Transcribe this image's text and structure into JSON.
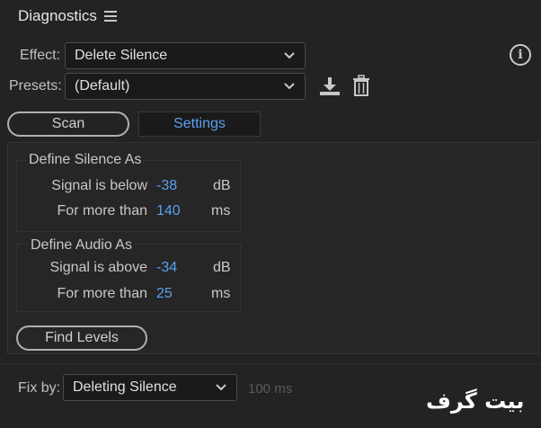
{
  "header": {
    "title": "Diagnostics",
    "menu_icon": "hamburger-menu-icon"
  },
  "effect": {
    "label": "Effect:",
    "value": "Delete Silence"
  },
  "presets": {
    "label": "Presets:",
    "value": "(Default)",
    "save_icon": "download-icon",
    "delete_icon": "trash-icon"
  },
  "info_icon": {
    "glyph": "i"
  },
  "tabs": {
    "scan": "Scan",
    "settings": "Settings",
    "active": "Settings"
  },
  "define_silence": {
    "title": "Define Silence As",
    "rows": [
      {
        "label": "Signal is below",
        "value": "-38",
        "unit": "dB"
      },
      {
        "label": "For more than",
        "value": "140",
        "unit": "ms"
      }
    ]
  },
  "define_audio": {
    "title": "Define Audio As",
    "rows": [
      {
        "label": "Signal is above",
        "value": "-34",
        "unit": "dB"
      },
      {
        "label": "For more than",
        "value": "25",
        "unit": "ms"
      }
    ]
  },
  "find_levels": {
    "label": "Find Levels"
  },
  "fix_by": {
    "label": "Fix by:",
    "value": "Deleting Silence",
    "extra": "100 ms"
  },
  "watermark": {
    "text": "بیت گرف"
  },
  "colors": {
    "accent": "#5aa0f0",
    "background": "#232323"
  }
}
